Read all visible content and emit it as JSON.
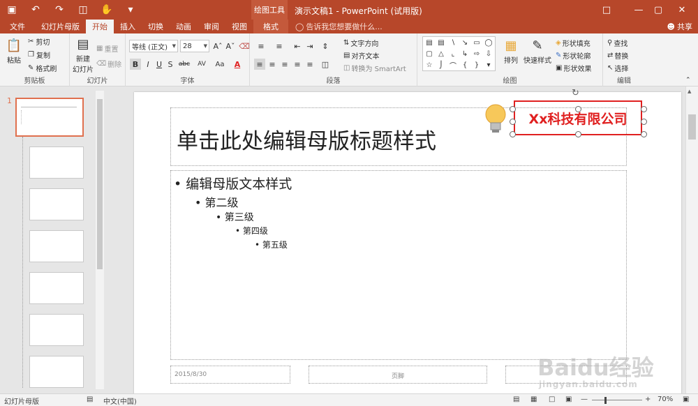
{
  "window": {
    "context_tool_title": "绘图工具",
    "doc_title": "演示文稿1 - PowerPoint (试用版)"
  },
  "tabs": [
    "文件",
    "幻灯片母版",
    "开始",
    "插入",
    "切换",
    "动画",
    "审阅",
    "视图",
    "格式"
  ],
  "active_tab": "开始",
  "tell_me": "告诉我您想要做什么...",
  "share": "共享",
  "ribbon": {
    "clipboard": {
      "label": "剪贴板",
      "paste": "粘贴",
      "cut": "剪切",
      "copy": "复制",
      "format_painter": "格式刷"
    },
    "slides": {
      "label": "幻灯片",
      "new_slide_line1": "新建",
      "new_slide_line2": "幻灯片",
      "reset": "重置",
      "delete": "删除"
    },
    "font": {
      "label": "字体",
      "font_name": "等线 (正文)",
      "font_size": "28"
    },
    "paragraph": {
      "label": "段落",
      "text_direction": "文字方向",
      "align_text": "对齐文本",
      "convert_smartart": "转换为 SmartArt"
    },
    "drawing": {
      "label": "绘图",
      "arrange": "排列",
      "quick_styles": "快速样式",
      "shape_fill": "形状填充",
      "shape_outline": "形状轮廓",
      "shape_effects": "形状效果"
    },
    "editing": {
      "label": "编辑",
      "find": "查找",
      "replace": "替换",
      "select": "选择"
    }
  },
  "slide": {
    "title": "单击此处编辑母版标题样式",
    "company": "Xx科技有限公司",
    "levels": [
      "编辑母版文本样式",
      "第二级",
      "第三级",
      "第四级",
      "第五级"
    ],
    "footer_date": "2015/8/30",
    "footer_center": "页脚"
  },
  "thumbnail_number": "1",
  "status": {
    "view": "幻灯片母版",
    "language": "中文(中国)",
    "zoom": "70%"
  },
  "watermark": {
    "brand": "Baidu经验",
    "url": "jingyan.baidu.com"
  },
  "colors": {
    "accent": "#b7472a",
    "highlight_red": "#e02020"
  }
}
